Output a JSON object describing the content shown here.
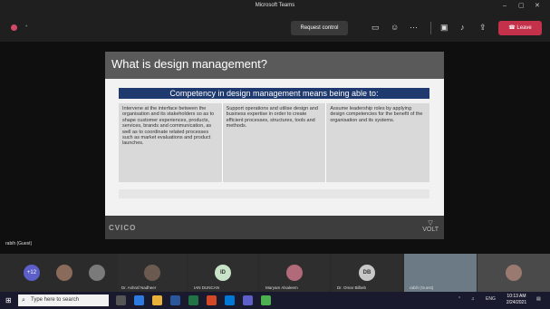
{
  "window": {
    "title": "Microsoft Teams",
    "controls": [
      "–",
      "▢",
      "✕"
    ]
  },
  "toolbar": {
    "request_control_label": "Request control",
    "leave_label": "Leave",
    "icons": [
      "chat-icon",
      "reactions-icon",
      "more-icon",
      "camera-off-icon",
      "mic-off-icon",
      "share-icon"
    ]
  },
  "slide": {
    "title": "What is design management?",
    "banner": "Competency in design management means being able to:",
    "columns": [
      "Intervene at the interface between the organisation and its stakeholders so as to shape customer experiences, products, services, brands and communication, as well as to coordinate related processes such as market evaluations and product launches.",
      "Support operations and utilise design and business expertise in order to create efficient processes, structures, tools and methods.",
      "Assume leadership roles by applying design competencies for the benefit of the organisation and its systems."
    ],
    "footer_left": "CVICO",
    "footer_right": "VOLT"
  },
  "stage": {
    "presenter_label": "rabih (Guest)"
  },
  "participants": {
    "more_count": "+12",
    "people": [
      {
        "name": "Dr. Ashraf Nadheer",
        "type": "photo"
      },
      {
        "name": "IAN DUNCAN",
        "initials": "ID",
        "type": "initials"
      },
      {
        "name": "Maryam Alsaleem",
        "type": "photo"
      },
      {
        "name": "Dr. Omar Bilbeb",
        "initials": "DB",
        "type": "initials"
      }
    ],
    "camera_name": "rabih (Guest)"
  },
  "taskbar": {
    "search_placeholder": "Type here to search",
    "lang": "ENG",
    "time": "10:13 AM",
    "date": "2/24/2021"
  },
  "colors": {
    "leave": "#c4314b",
    "banner": "#1f3a6e",
    "accent": "#5b5fc7"
  }
}
